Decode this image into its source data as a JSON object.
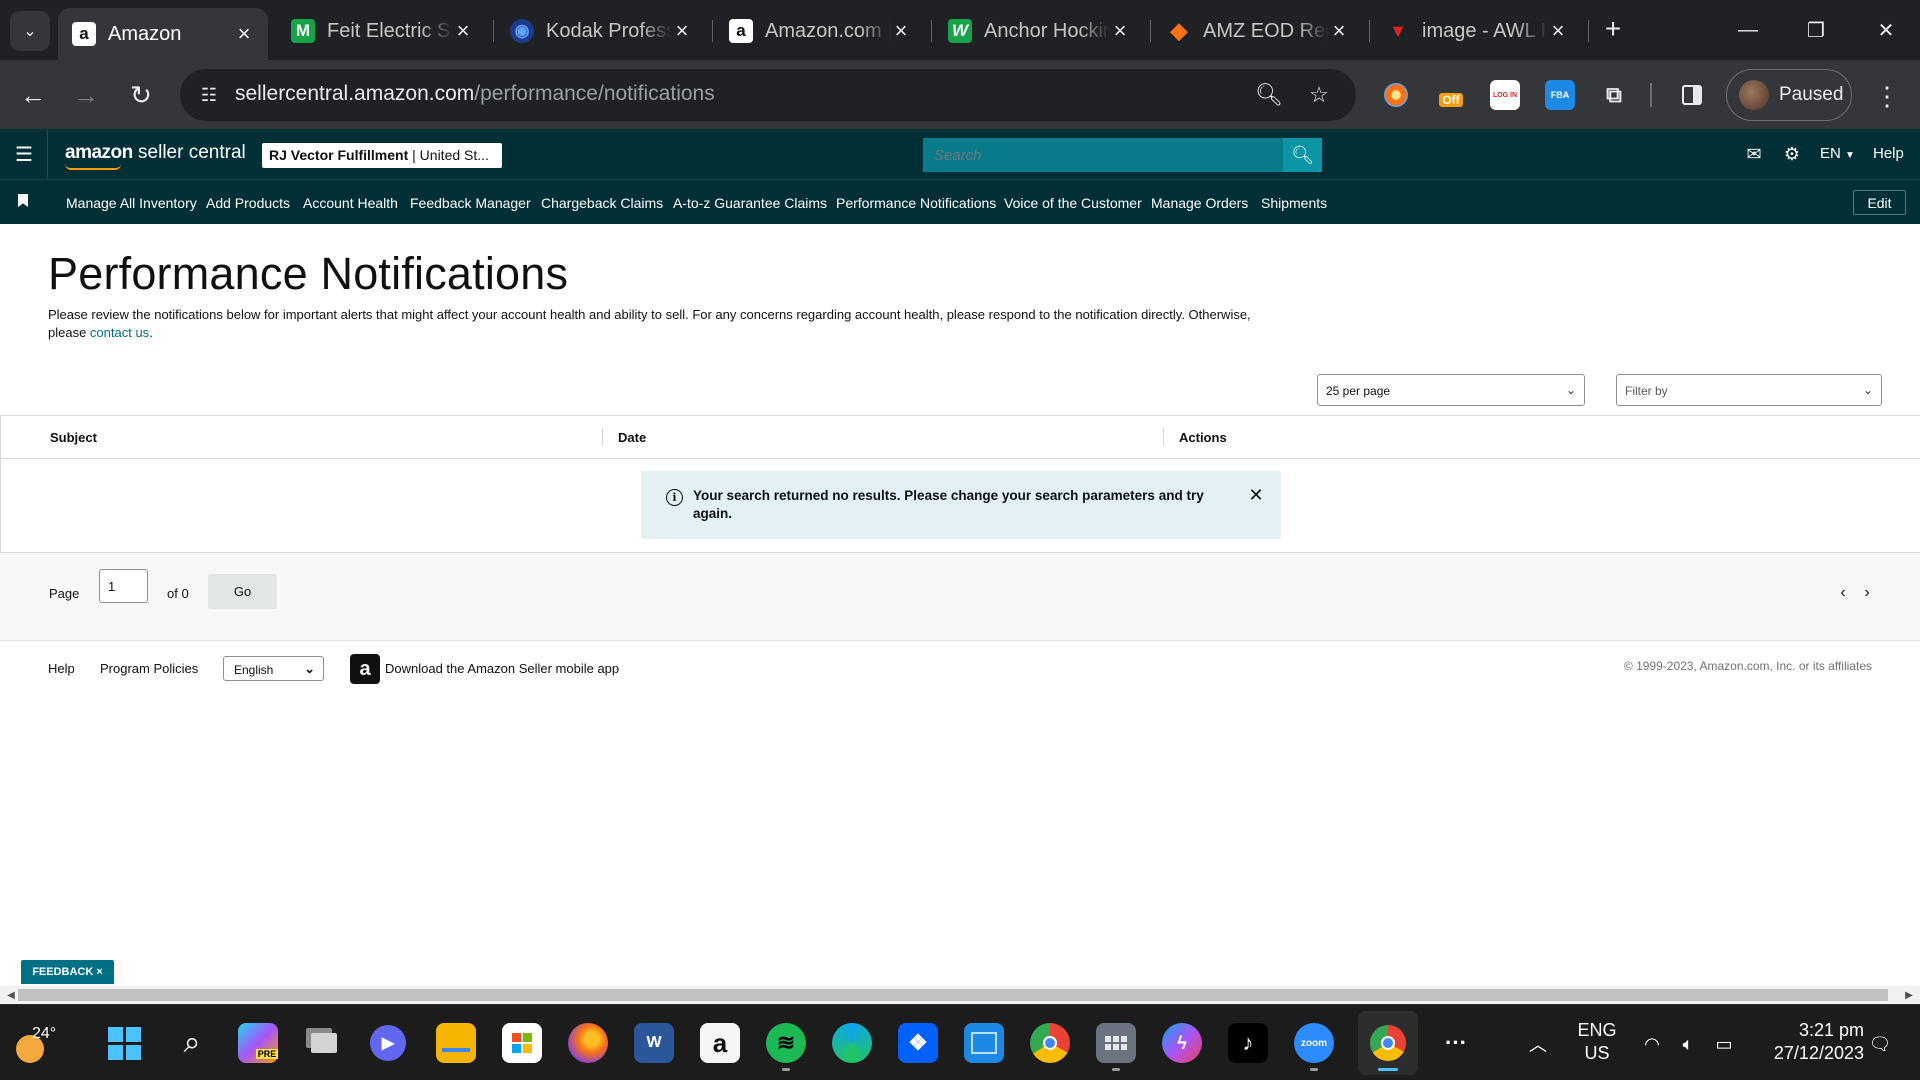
{
  "browser": {
    "tabs": [
      {
        "title": "Amazon",
        "favicon": "a",
        "favicon_bg": "#ffffff",
        "favicon_fg": "#0f1111",
        "active": true
      },
      {
        "title": "Feit Electric Smart",
        "favicon": "M",
        "favicon_bg": "#16a34a",
        "favicon_fg": "#ffffff",
        "active": false
      },
      {
        "title": "Kodak Professional",
        "favicon": "◉",
        "favicon_bg": "#1e3a8a",
        "favicon_fg": "#60a5fa",
        "active": false
      },
      {
        "title": "Amazon.com | ",
        "favicon": "a",
        "favicon_bg": "#ffffff",
        "favicon_fg": "#0f1111",
        "active": false
      },
      {
        "title": "Anchor Hocking",
        "favicon": "W",
        "favicon_bg": "#16a34a",
        "favicon_fg": "#ffffff",
        "active": false
      },
      {
        "title": "AMZ EOD Report",
        "favicon": "◆",
        "favicon_bg": "#f97316",
        "favicon_fg": "#3b82f6",
        "active": false
      },
      {
        "title": "image - AWL Image",
        "favicon": "▼",
        "favicon_bg": "#202124",
        "favicon_fg": "#dc2626",
        "active": false
      }
    ],
    "new_tab_label": "+",
    "url_domain": "sellercentral.amazon.com",
    "url_path": "/performance/notifications",
    "profile_label": "Paused",
    "extension_off_badge": "Off",
    "extension_fba_label": "FBA",
    "extension_login_label": "LOG IN"
  },
  "header": {
    "logo_brand": "amazon",
    "logo_suffix": " seller central",
    "account_name": "RJ Vector Fulfillment",
    "account_region": " | United St...",
    "search_placeholder": "Search",
    "language": "EN",
    "help": "Help"
  },
  "nav": {
    "items": [
      "Manage All Inventory",
      "Add Products",
      "Account Health",
      "Feedback Manager",
      "Chargeback Claims",
      "A-to-z Guarantee Claims",
      "Performance Notifications",
      "Voice of the Customer",
      "Manage Orders",
      "Shipments"
    ],
    "edit_label": "Edit"
  },
  "main": {
    "title": "Performance Notifications",
    "intro_text": "Please review the notifications below for important alerts that might affect your account health and ability to sell. For any concerns regarding account health, please respond to the notification directly. Otherwise, please ",
    "contact_link": "contact us",
    "intro_end": ".",
    "per_page": "25 per page",
    "filter_placeholder": "Filter by",
    "table": {
      "columns": [
        "Subject",
        "Date",
        "Actions"
      ],
      "empty_message": "Your search returned no results. Please change your search parameters and try again."
    },
    "pagination": {
      "page_label": "Page",
      "page_value": "1",
      "of_label": "of 0",
      "go_label": "Go"
    }
  },
  "footer": {
    "help": "Help",
    "program_policies": "Program Policies",
    "language": "English",
    "app_promo": "Download the Amazon Seller mobile app",
    "copyright": "© 1999-2023, Amazon.com, Inc. or its affiliates"
  },
  "feedback": {
    "label": "FEEDBACK",
    "close": "×"
  },
  "taskbar": {
    "weather_temp": "24°",
    "copilot_badge": "PRE",
    "word_label": "W",
    "zoom_label": "zoom",
    "lang_line1": "ENG",
    "lang_line2": "US",
    "time": "3:21 pm",
    "date": "27/12/2023"
  },
  "colors": {
    "seller_central_header": "#002f36",
    "link": "#007185",
    "alert_bg": "#e3f1f4",
    "search_bg": "#077b8a"
  }
}
